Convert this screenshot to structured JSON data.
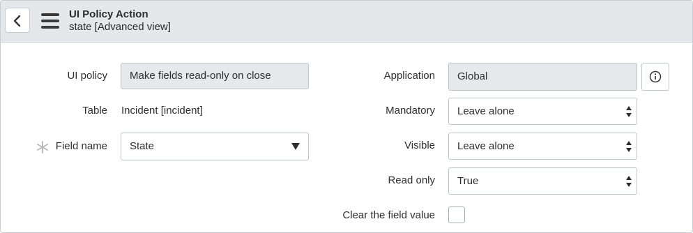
{
  "header": {
    "title": "UI Policy Action",
    "subtitle": "state [Advanced view]"
  },
  "form": {
    "ui_policy": {
      "label": "UI policy",
      "value": "Make fields read-only on close"
    },
    "table": {
      "label": "Table",
      "value": "Incident [incident]"
    },
    "field_name": {
      "label": "Field name",
      "value": "State",
      "required": true
    },
    "application": {
      "label": "Application",
      "value": "Global"
    },
    "mandatory": {
      "label": "Mandatory",
      "value": "Leave alone"
    },
    "visible": {
      "label": "Visible",
      "value": "Leave alone"
    },
    "read_only": {
      "label": "Read only",
      "value": "True"
    },
    "clear_value": {
      "label": "Clear the field value",
      "checked": false
    }
  },
  "icons": {
    "back": "chevron-left-icon",
    "menu": "hamburger-menu-icon",
    "info": "info-icon",
    "required": "asterisk-icon"
  }
}
